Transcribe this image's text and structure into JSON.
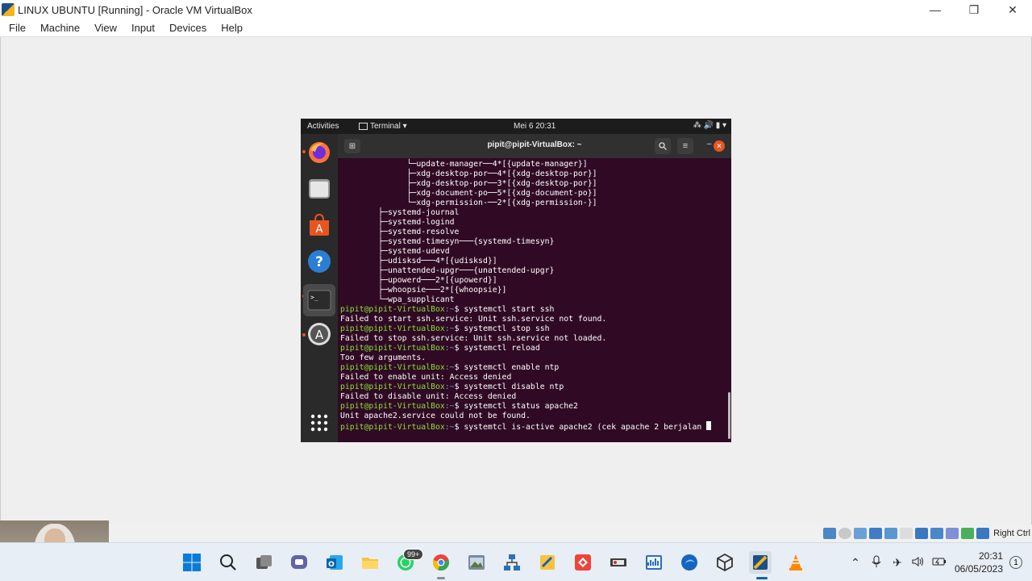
{
  "host": {
    "title": "LINUX UBUNTU [Running] - Oracle VM VirtualBox",
    "menu": [
      "File",
      "Machine",
      "View",
      "Input",
      "Devices",
      "Help"
    ],
    "controls": {
      "minimize": "—",
      "restore": "❐",
      "close": "✕"
    },
    "status_hostkey": "Right Ctrl"
  },
  "guest": {
    "topbar": {
      "activities": "Activities",
      "app_menu": "Terminal ▾",
      "clock": "Mei 6  20:31",
      "tray": "⁂  🔊  ▮ ▾"
    },
    "terminal": {
      "title": "pipit@pipit-VirtualBox: ~",
      "prompt_user": "pipit@pipit-VirtualBox",
      "prompt_path": ":~",
      "prompt_dollar": "$ ",
      "lines": [
        {
          "t": "out",
          "text": "              └─update-manager──4*[{update-manager}]"
        },
        {
          "t": "out",
          "text": "              ├─xdg-desktop-por──4*[{xdg-desktop-por}]"
        },
        {
          "t": "out",
          "text": "              ├─xdg-desktop-por──3*[{xdg-desktop-por}]"
        },
        {
          "t": "out",
          "text": "              ├─xdg-document-po──5*[{xdg-document-po}]"
        },
        {
          "t": "out",
          "text": "              └─xdg-permission-──2*[{xdg-permission-}]"
        },
        {
          "t": "out",
          "text": "        ├─systemd-journal"
        },
        {
          "t": "out",
          "text": "        ├─systemd-logind"
        },
        {
          "t": "out",
          "text": "        ├─systemd-resolve"
        },
        {
          "t": "out",
          "text": "        ├─systemd-timesyn───{systemd-timesyn}"
        },
        {
          "t": "out",
          "text": "        ├─systemd-udevd"
        },
        {
          "t": "out",
          "text": "        ├─udisksd───4*[{udisksd}]"
        },
        {
          "t": "out",
          "text": "        ├─unattended-upgr───{unattended-upgr}"
        },
        {
          "t": "out",
          "text": "        ├─upowerd───2*[{upowerd}]"
        },
        {
          "t": "out",
          "text": "        ├─whoopsie───2*[{whoopsie}]"
        },
        {
          "t": "out",
          "text": "        └─wpa_supplicant"
        },
        {
          "t": "cmd",
          "text": "systemctl start ssh"
        },
        {
          "t": "out",
          "text": "Failed to start ssh.service: Unit ssh.service not found."
        },
        {
          "t": "cmd",
          "text": "systemctl stop ssh"
        },
        {
          "t": "out",
          "text": "Failed to stop ssh.service: Unit ssh.service not loaded."
        },
        {
          "t": "cmd",
          "text": "systemctl reload"
        },
        {
          "t": "out",
          "text": "Too few arguments."
        },
        {
          "t": "cmd",
          "text": "systemctl enable ntp"
        },
        {
          "t": "out",
          "text": "Failed to enable unit: Access denied"
        },
        {
          "t": "cmd",
          "text": "systemctl disable ntp"
        },
        {
          "t": "out",
          "text": "Failed to disable unit: Access denied"
        },
        {
          "t": "cmd",
          "text": "systemctl status apache2"
        },
        {
          "t": "out",
          "text": "Unit apache2.service could not be found."
        },
        {
          "t": "cmd",
          "text": "systemtcl is-active apache2 (cek apache 2 berjalan ",
          "cursor": true
        }
      ]
    },
    "dock": [
      "firefox-icon",
      "files-icon",
      "app-center-icon",
      "help-icon",
      "terminal-icon",
      "software-updater-icon",
      "show-apps-icon"
    ]
  },
  "taskbar": {
    "whatsapp_badge": "99+",
    "time": "20:31",
    "date": "06/05/2023",
    "notifications": "1"
  }
}
